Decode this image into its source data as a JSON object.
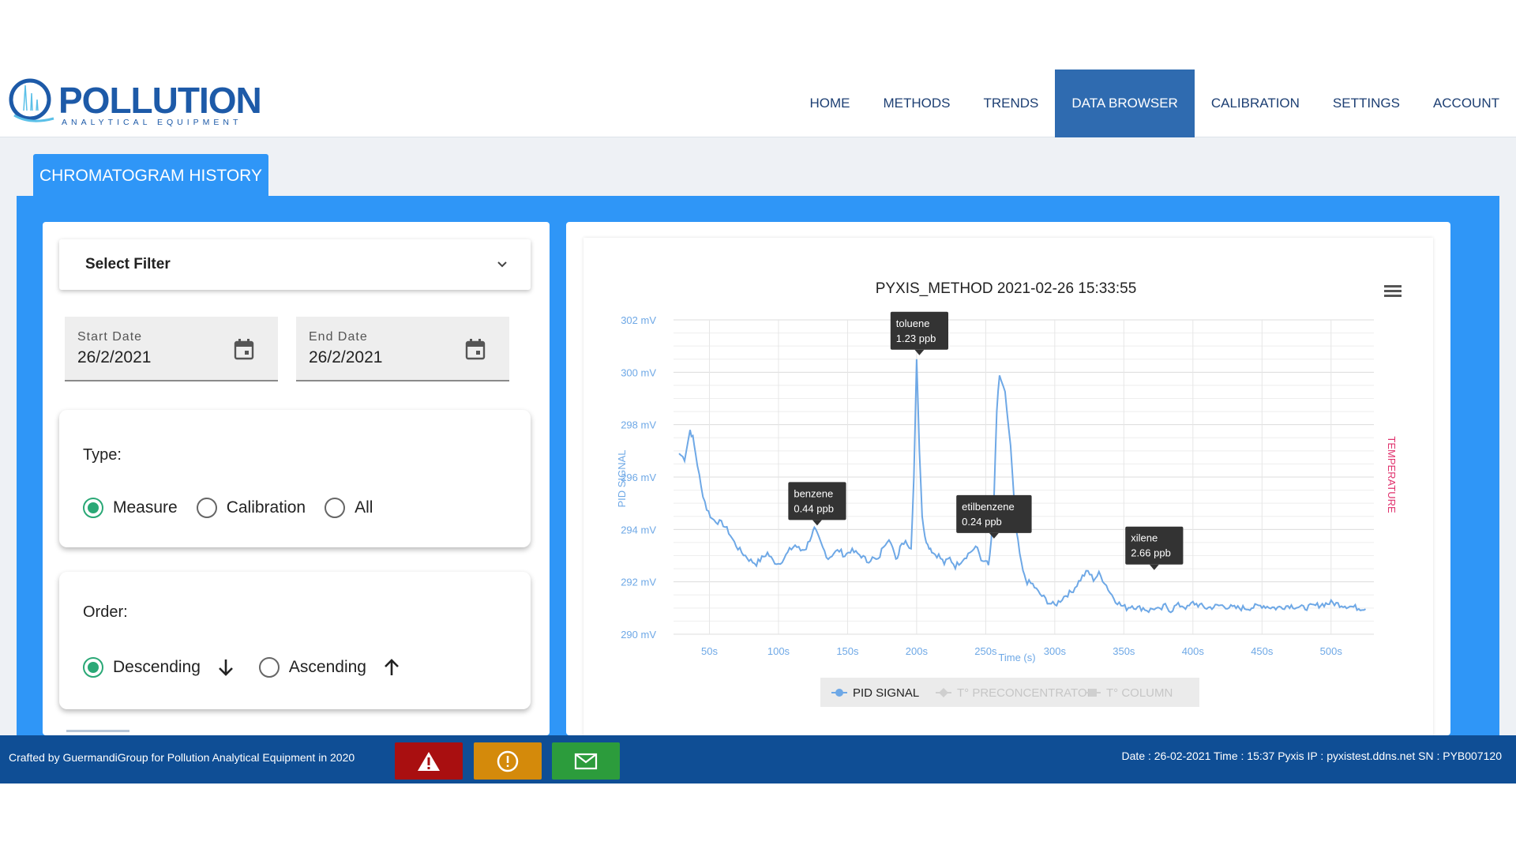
{
  "brand": {
    "name": "POLLUTION",
    "tagline": "ANALYTICAL EQUIPMENT",
    "color": "#1d5aa8"
  },
  "nav": {
    "items": [
      "HOME",
      "METHODS",
      "TRENDS",
      "DATA BROWSER",
      "CALIBRATION",
      "SETTINGS",
      "ACCOUNT"
    ],
    "active": "DATA BROWSER"
  },
  "tab": {
    "label": "CHROMATOGRAM HISTORY"
  },
  "filters": {
    "select_label": "Select Filter",
    "start_date": {
      "label": "Start Date",
      "value": "26/2/2021"
    },
    "end_date": {
      "label": "End Date",
      "value": "26/2/2021"
    },
    "type": {
      "title": "Type:",
      "options": [
        "Measure",
        "Calibration",
        "All"
      ],
      "selected": "Measure"
    },
    "order": {
      "title": "Order:",
      "options": [
        "Descending",
        "Ascending"
      ],
      "selected": "Descending"
    }
  },
  "chart_data": {
    "type": "line",
    "title": "PYXIS_METHOD 2021-02-26 15:33:55",
    "xlabel": "Time (s)",
    "ylabel": "PID SIGNAL",
    "y2label": "TEMPERATURE",
    "xlim": [
      24,
      531
    ],
    "ylim": [
      290,
      302
    ],
    "x_ticks": [
      50,
      100,
      150,
      200,
      250,
      300,
      350,
      400,
      450,
      500
    ],
    "x_tick_labels": [
      "50s",
      "100s",
      "150s",
      "200s",
      "250s",
      "300s",
      "350s",
      "400s",
      "450s",
      "500s"
    ],
    "y_ticks": [
      290,
      292,
      294,
      296,
      298,
      300,
      302
    ],
    "y_tick_labels": [
      "290 mV",
      "292 mV",
      "294 mV",
      "296 mV",
      "298 mV",
      "300 mV",
      "302 mV"
    ],
    "grid": true,
    "legend_position": "bottom-center",
    "series": [
      {
        "name": "PID SIGNAL",
        "color": "#6ea8e6",
        "x": [
          28,
          32,
          36,
          38,
          40,
          44,
          48,
          52,
          56,
          60,
          64,
          68,
          72,
          76,
          80,
          84,
          88,
          92,
          96,
          100,
          104,
          108,
          112,
          116,
          120,
          124,
          126,
          128,
          132,
          136,
          140,
          144,
          148,
          152,
          156,
          160,
          164,
          168,
          172,
          176,
          180,
          184,
          186,
          188,
          192,
          196,
          198,
          200,
          202,
          204,
          206,
          208,
          210,
          212,
          216,
          220,
          224,
          228,
          232,
          236,
          240,
          244,
          248,
          250,
          252,
          254,
          256,
          258,
          260,
          264,
          268,
          272,
          276,
          278,
          280,
          284,
          288,
          292,
          296,
          300,
          304,
          308,
          312,
          316,
          320,
          324,
          328,
          332,
          336,
          340,
          344,
          348,
          352,
          356,
          360,
          364,
          368,
          372,
          376,
          380,
          384,
          388,
          392,
          396,
          400,
          410,
          420,
          430,
          440,
          450,
          460,
          470,
          480,
          490,
          500,
          510,
          520,
          525
        ],
        "y": [
          296.9,
          296.7,
          297.8,
          297.5,
          296.9,
          295.6,
          294.8,
          294.4,
          294.3,
          294.2,
          293.9,
          293.5,
          293.2,
          293.0,
          292.8,
          292.7,
          292.9,
          293.1,
          292.8,
          292.7,
          292.9,
          293.2,
          293.4,
          293.2,
          293.3,
          293.8,
          294.0,
          293.8,
          293.3,
          292.9,
          293.1,
          293.2,
          293.0,
          293.2,
          293.1,
          293.0,
          292.8,
          292.9,
          292.8,
          293.4,
          293.7,
          293.0,
          292.9,
          293.4,
          293.6,
          293.2,
          296.0,
          300.5,
          297.0,
          294.5,
          293.8,
          293.4,
          293.3,
          293.1,
          293.0,
          292.7,
          292.9,
          292.6,
          292.8,
          293.0,
          293.2,
          293.3,
          292.7,
          292.8,
          292.6,
          293.5,
          295.2,
          298.5,
          299.9,
          299.2,
          297.2,
          294.0,
          292.6,
          292.2,
          292.0,
          291.9,
          291.6,
          291.4,
          291.2,
          291.1,
          291.3,
          291.5,
          291.6,
          291.9,
          292.2,
          292.4,
          292.1,
          292.3,
          292.0,
          291.6,
          291.3,
          291.1,
          291.0,
          291.1,
          291.0,
          291.0,
          290.9,
          291.0,
          290.9,
          291.1,
          290.9,
          291.1,
          291.1,
          291.0,
          291.2,
          291.0,
          291.1,
          291.0,
          291.0,
          291.1,
          291.0,
          291.1,
          291.0,
          291.1,
          291.2,
          291.1,
          291.0,
          291.0
        ]
      }
    ],
    "annotations": [
      {
        "x": 128,
        "y": 294.0,
        "name": "benzene",
        "value": "0.44 ppb"
      },
      {
        "x": 202,
        "y": 300.5,
        "name": "toluene",
        "value": "1.23 ppb"
      },
      {
        "x": 256,
        "y": 293.5,
        "name": "etilbenzene",
        "value": "0.24 ppb"
      },
      {
        "x": 372,
        "y": 292.3,
        "name": "xilene",
        "value": "2.66 ppb"
      }
    ],
    "legend": [
      {
        "name": "PID SIGNAL",
        "active": true,
        "color": "#6ea8e6"
      },
      {
        "name": "T° PRECONCENTRATOR",
        "active": false,
        "color": "#cfcfcf"
      },
      {
        "name": "T° COLUMN",
        "active": false,
        "color": "#cfcfcf"
      }
    ]
  },
  "footer": {
    "credit": "Crafted by GuermandiGroup for Pollution Analytical Equipment in 2020",
    "info": "Date : 26-02-2021  Time : 15:37  Pyxis IP : pyxistest.ddns.net  SN : PYB007120",
    "buttons": [
      {
        "icon": "warning-triangle-icon",
        "color": "#a90f10"
      },
      {
        "icon": "exclamation-circle-icon",
        "color": "#d48a0b"
      },
      {
        "icon": "envelope-icon",
        "color": "#2c9c3c"
      }
    ]
  }
}
